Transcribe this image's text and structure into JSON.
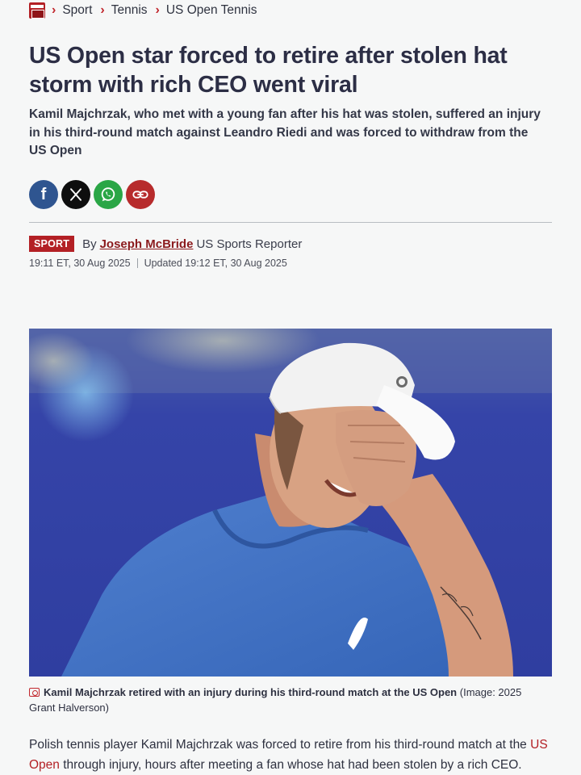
{
  "breadcrumb": {
    "logo": "mirror-logo",
    "items": [
      "Sport",
      "Tennis",
      "US Open Tennis"
    ]
  },
  "article": {
    "headline": "US Open star forced to retire after stolen hat storm with rich CEO went viral",
    "standfirst": "Kamil Majchrzak, who met with a young fan after his hat was stolen, suffered an injury in his third-round match against Leandro Riedi and was forced to withdraw from the US Open",
    "section_tag": "SPORT",
    "by": "By",
    "author": "Joseph McBride",
    "author_role": "US Sports Reporter",
    "published": "19:11 ET, 30 Aug 2025",
    "updated": "Updated 19:12 ET, 30 Aug 2025",
    "caption": "Kamil Majchrzak retired with an injury during his third-round match at the US Open",
    "caption_credit": "(Image: 2025 Grant Halverson)",
    "body_part1": "Polish tennis player Kamil Majchrzak was forced to retire from his third-round match at the",
    "body_link": "US Open",
    "body_part2": "through injury, hours after meeting a fan whose hat had been stolen by a rich CEO."
  },
  "share": {
    "facebook_icon": "facebook-icon",
    "x_icon": "x-icon",
    "whatsapp_icon": "whatsapp-icon",
    "link_icon": "link-icon"
  },
  "colors": {
    "accent": "#b32025",
    "headline": "#2c2e45",
    "background": "#f6f7f7"
  }
}
